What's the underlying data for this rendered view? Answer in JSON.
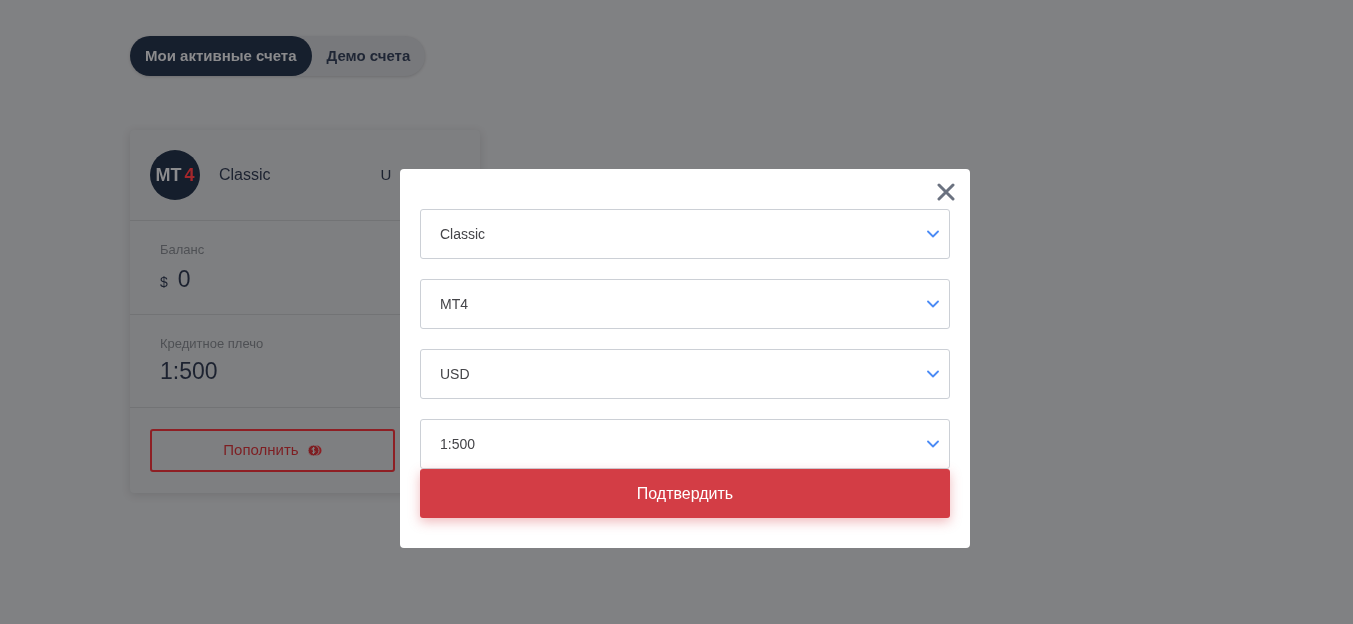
{
  "tabs": [
    {
      "label": "Мои активные счета",
      "selected": true
    },
    {
      "label": "Демо счета",
      "selected": false
    }
  ],
  "account_card": {
    "logo": {
      "text": "MT",
      "accent": "4"
    },
    "name": "Classic",
    "currency_partial": "U",
    "balance": {
      "label": "Баланс",
      "currency_symbol": "$",
      "value": "0"
    },
    "leverage": {
      "label": "Кредитное плечо",
      "value": "1:500"
    },
    "deposit_button": "Пополнить"
  },
  "modal": {
    "selects": [
      {
        "value": "Classic"
      },
      {
        "value": "MT4"
      },
      {
        "value": "USD"
      },
      {
        "value": "1:500"
      }
    ],
    "confirm_button": "Подтвердить"
  }
}
